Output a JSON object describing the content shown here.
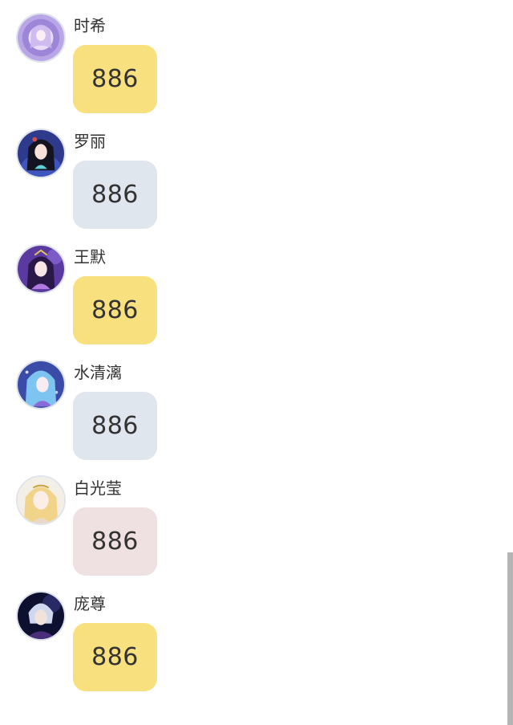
{
  "messages": [
    {
      "name": "时希",
      "text": "886",
      "bubble_color": "#f8e07f",
      "avatar_icon": "purple-hair-girl-avatar"
    },
    {
      "name": "罗丽",
      "text": "886",
      "bubble_color": "#e0e6ee",
      "avatar_icon": "dark-hair-girl-avatar"
    },
    {
      "name": "王默",
      "text": "886",
      "bubble_color": "#f8e07f",
      "avatar_icon": "purple-princess-avatar"
    },
    {
      "name": "水清漓",
      "text": "886",
      "bubble_color": "#e0e6ee",
      "avatar_icon": "blue-hair-girl-avatar"
    },
    {
      "name": "白光莹",
      "text": "886",
      "bubble_color": "#efe1e1",
      "avatar_icon": "blonde-girl-avatar"
    },
    {
      "name": "庞尊",
      "text": "886",
      "bubble_color": "#f8e07f",
      "avatar_icon": "silver-hair-boy-avatar"
    }
  ]
}
